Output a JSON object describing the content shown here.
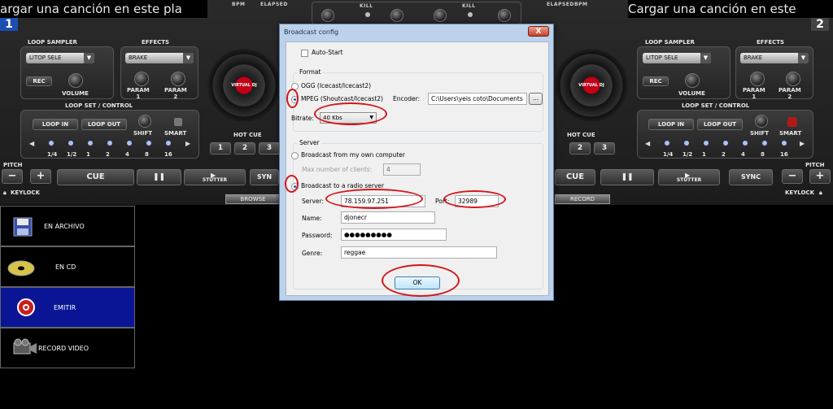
{
  "app": {
    "load_prompt_left": "argar una canción en este pla",
    "load_prompt_right": "Cargar una canción en este",
    "deck_left_number": "1",
    "deck_right_number": "2",
    "header_labels": {
      "bpm": "BPM",
      "elapsed": "ELAPSED",
      "kill": "KILL"
    }
  },
  "deck_left": {
    "loop_sampler_label": "LOOP SAMPLER",
    "effects_label": "EFFECTS",
    "sampler_select": "LITOP SELE",
    "effects_select": "BRAKE",
    "rec_label": "REC",
    "volume_label": "VOLUME",
    "param1_label": "PARAM\n1",
    "param2_label": "PARAM\n2",
    "loop_set_label": "LOOP SET / CONTROL",
    "loop_in": "LOOP IN",
    "loop_out": "LOOP OUT",
    "shift": "SHIFT",
    "smart": "SMART",
    "loop_lengths": [
      "1/4",
      "1/2",
      "1",
      "2",
      "4",
      "8",
      "16"
    ],
    "pitch": "PITCH",
    "pitch_minus": "−",
    "pitch_plus": "+",
    "cue": "CUE",
    "play_pause": "❚❚",
    "stutter": "STUTTER",
    "sync": "SYN",
    "keylock": "KEYLOCK",
    "hot_cue": "HOT CUE",
    "hot_cues": [
      "1",
      "2",
      "3"
    ],
    "turntable_logo": "VIRTUAL DJ"
  },
  "deck_right": {
    "loop_sampler_label": "LOOP SAMPLER",
    "effects_label": "EFFECTS",
    "sampler_select": "LITOP SELE",
    "effects_select": "BRAKE",
    "rec_label": "REC",
    "volume_label": "VOLUME",
    "param1_label": "PARAM\n1",
    "param2_label": "PARAM\n2",
    "loop_set_label": "LOOP SET / CONTROL",
    "loop_in": "LOOP IN",
    "loop_out": "LOOP OUT",
    "shift": "SHIFT",
    "smart": "SMART",
    "loop_lengths": [
      "1/4",
      "1/2",
      "1",
      "2",
      "4",
      "8",
      "16"
    ],
    "pitch": "PITCH",
    "pitch_minus": "−",
    "pitch_plus": "+",
    "cue": "CUE",
    "play_pause": "❚❚",
    "stutter": "STUTTER",
    "sync": "SYNC",
    "keylock": "KEYLOCK",
    "hot_cue": "HOT CUE",
    "hot_cues": [
      "2",
      "3"
    ],
    "turntable_logo": "VIRTUAL DJ"
  },
  "bottom_tabs": {
    "browser": "BROWSE",
    "record": "RECORD"
  },
  "record_menu": [
    {
      "label": "EN ARCHIVO",
      "icon": "floppy-disk-icon",
      "selected": false
    },
    {
      "label": "EN CD",
      "icon": "cd-disc-icon",
      "selected": false
    },
    {
      "label": "EMITIR",
      "icon": "broadcast-icon",
      "selected": true
    },
    {
      "label": "RECORD VIDEO",
      "icon": "video-camera-icon",
      "selected": false
    }
  ],
  "dialog": {
    "title": "Broadcast config",
    "close_label": "X",
    "auto_start_label": "Auto-Start",
    "auto_start_checked": false,
    "format_group": "Format",
    "format_ogg": "OGG (Icecast/Icecast2)",
    "format_mpeg": "MPEG (Shoutcast/Icecast2)",
    "selected_format": "mpeg",
    "encoder_label": "Encoder:",
    "encoder_value": "C:\\Users\\yeis coto\\Documents",
    "browse_label": "...",
    "bitrate_label": "Bitrate:",
    "bitrate_value": "40 Kbs",
    "server_group": "Server",
    "broadcast_own": "Broadcast from my own computer",
    "max_clients_label": "Max number of clients:",
    "max_clients_value": "4",
    "broadcast_radio": "Broadcast to a radio server",
    "selected_server_mode": "radio",
    "server_label": "Server:",
    "server_value": "78.159.97.251",
    "port_label": "Port:",
    "port_value": "32989",
    "name_label": "Name:",
    "name_value": "djonecr",
    "password_label": "Password:",
    "password_value": "●●●●●●●●●",
    "genre_label": "Genre:",
    "genre_value": "reggae",
    "ok_label": "OK"
  },
  "colors": {
    "highlight_ring": "#d3161c",
    "selected_menu": "#0a1596"
  }
}
